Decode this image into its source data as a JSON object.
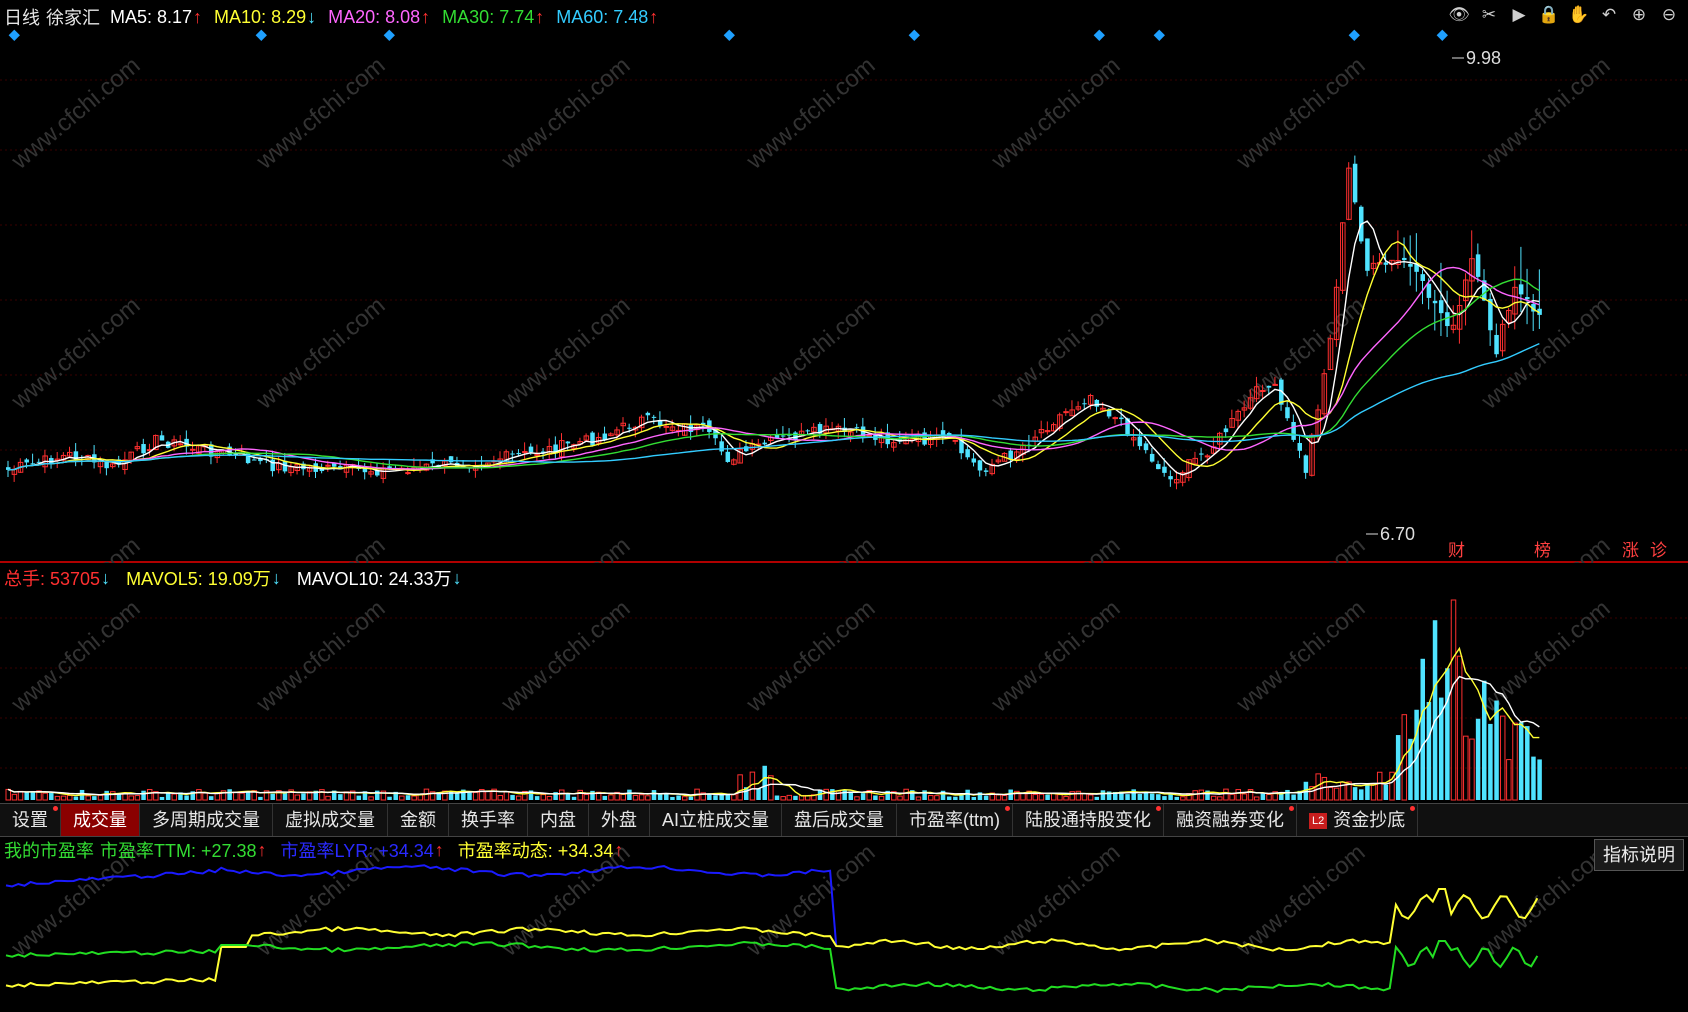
{
  "main": {
    "period_label": "日线",
    "stock_name": "徐家汇",
    "ma": [
      {
        "label": "MA5: 8.17",
        "arrow": "↑",
        "dir": "up",
        "color": "#ffffff"
      },
      {
        "label": "MA10: 8.29",
        "arrow": "↓",
        "dir": "down",
        "color": "#ffff33"
      },
      {
        "label": "MA20: 8.08",
        "arrow": "↑",
        "dir": "up",
        "color": "#ff66ff"
      },
      {
        "label": "MA30: 7.74",
        "arrow": "↑",
        "dir": "up",
        "color": "#33dd33"
      },
      {
        "label": "MA60: 7.48",
        "arrow": "↑",
        "dir": "up",
        "color": "#33ccff"
      }
    ],
    "high_label": "9.98",
    "low_label": "6.70",
    "event_markers": [
      "财",
      "榜",
      "涨",
      "诊"
    ]
  },
  "toolbar_icons": [
    "eye-icon",
    "scissors-icon",
    "play-icon",
    "lock-icon",
    "hand-icon",
    "undo-icon",
    "zoom-in-icon",
    "zoom-out-icon"
  ],
  "volume": {
    "total_label": "总手: 53705",
    "total_arrow": "↓",
    "mavol5_label": "MAVOL5: 19.09万",
    "mavol5_arrow": "↓",
    "mavol10_label": "MAVOL10: 24.33万",
    "mavol10_arrow": "↓"
  },
  "tabs": [
    {
      "label": "设置",
      "dot": true,
      "active": false,
      "l2": false
    },
    {
      "label": "成交量",
      "dot": false,
      "active": true,
      "l2": false
    },
    {
      "label": "多周期成交量",
      "dot": false,
      "active": false,
      "l2": false
    },
    {
      "label": "虚拟成交量",
      "dot": false,
      "active": false,
      "l2": false
    },
    {
      "label": "金额",
      "dot": false,
      "active": false,
      "l2": false
    },
    {
      "label": "换手率",
      "dot": false,
      "active": false,
      "l2": false
    },
    {
      "label": "内盘",
      "dot": false,
      "active": false,
      "l2": false
    },
    {
      "label": "外盘",
      "dot": false,
      "active": false,
      "l2": false
    },
    {
      "label": "AI立桩成交量",
      "dot": false,
      "active": false,
      "l2": false
    },
    {
      "label": "盘后成交量",
      "dot": false,
      "active": false,
      "l2": false
    },
    {
      "label": "市盈率(ttm)",
      "dot": true,
      "active": false,
      "l2": false
    },
    {
      "label": "陆股通持股变化",
      "dot": true,
      "active": false,
      "l2": false
    },
    {
      "label": "融资融券变化",
      "dot": true,
      "active": false,
      "l2": false
    },
    {
      "label": "资金抄底",
      "dot": true,
      "active": false,
      "l2": true
    }
  ],
  "l2_badge": "L2",
  "pe": {
    "title": "我的市盈率",
    "ttm_label": "市盈率TTM: +27.38",
    "ttm_arrow": "↑",
    "lyr_label": "市盈率LYR: +34.34",
    "lyr_arrow": "↑",
    "dyn_label": "市盈率动态: +34.34",
    "dyn_arrow": "↑",
    "explain_button": "指标说明"
  },
  "watermark": "www.cfchi.com",
  "colors": {
    "up": "#ff3030",
    "down": "#4fe3ff",
    "tab_active": "#8b0000"
  }
}
